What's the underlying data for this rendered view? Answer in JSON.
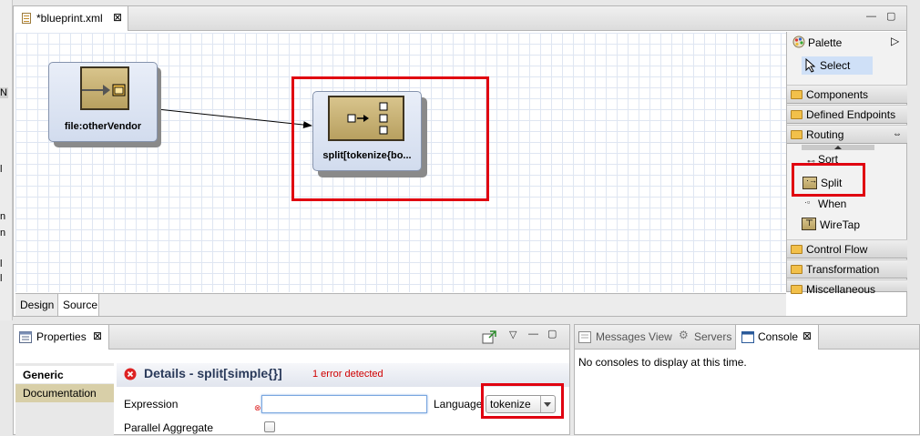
{
  "left_strip": {
    "chars": [
      "N",
      "l",
      "n",
      "n",
      "l",
      "l"
    ]
  },
  "editor": {
    "tab_label": "*blueprint.xml",
    "tab_close": "⊠",
    "minimize": "—",
    "maximize": "▢"
  },
  "canvas": {
    "nodes": [
      {
        "label": "file:otherVendor"
      },
      {
        "label": "split[tokenize{bo..."
      }
    ]
  },
  "palette": {
    "title": "Palette",
    "select_label": "Select",
    "expand_glyph": "▷",
    "drawers_top": [
      "Components",
      "Defined Endpoints",
      "Routing"
    ],
    "routing_collapse_glyph": "⇔",
    "routing_items": [
      "Sort",
      "Split",
      "When",
      "WireTap"
    ],
    "drawers_bottom": [
      "Control Flow",
      "Transformation",
      "Miscellaneous"
    ]
  },
  "editor_bottom_tabs": [
    "Design",
    "Source"
  ],
  "properties": {
    "tab_label": "Properties",
    "tab_close": "⊠",
    "side_tabs": [
      "Generic",
      "Documentation"
    ],
    "details_title": "Details - split[simple{}]",
    "error_text": "1 error detected",
    "expression_label": "Expression",
    "expression_value": "",
    "language_label": "Language",
    "language_value": "tokenize",
    "parallel_label": "Parallel Aggregate",
    "menu_glyph": "▽",
    "minimize": "—",
    "maximize": "▢"
  },
  "console": {
    "tabs": [
      "Messages View",
      "Servers",
      "Console"
    ],
    "tab_close": "⊠",
    "message": "No consoles to display at this time."
  },
  "colors": {
    "highlight_red": "#e00010",
    "palette_select_bg": "#cfe0f7",
    "error_red": "#d00000",
    "node_icon_gold": "#c8b070"
  }
}
